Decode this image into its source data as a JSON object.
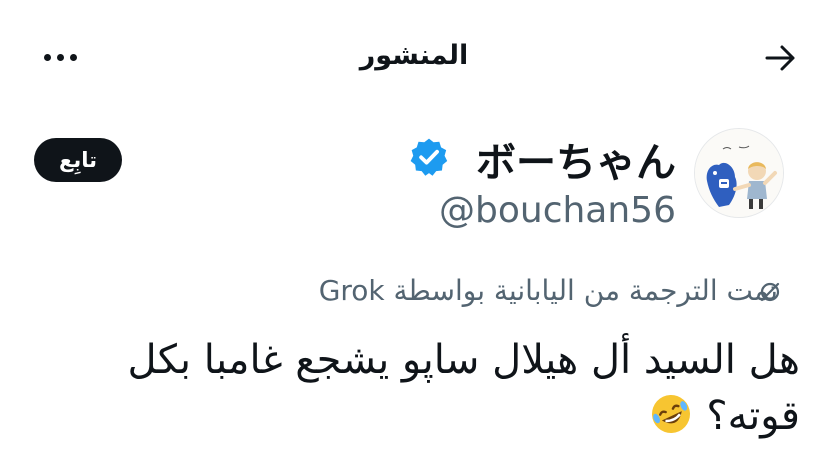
{
  "header": {
    "title": "المنشور",
    "back_icon": "arrow-right-icon",
    "more_icon": "more-options-icon"
  },
  "user": {
    "display_name": "ボーちゃん",
    "handle": "@bouchan56",
    "verified": true,
    "verified_color": "#1d9bf0",
    "avatar_icon": "avatar-illustration"
  },
  "follow_button": {
    "label": "تابِع"
  },
  "translation_note": "تمت الترجمة من اليابانية بواسطة Grok",
  "post": {
    "text": "هل السيد أل هيلال ساپو يشجع غامبا بكل قوته؟",
    "emoji": "rolling-on-the-floor-laughing-icon"
  }
}
